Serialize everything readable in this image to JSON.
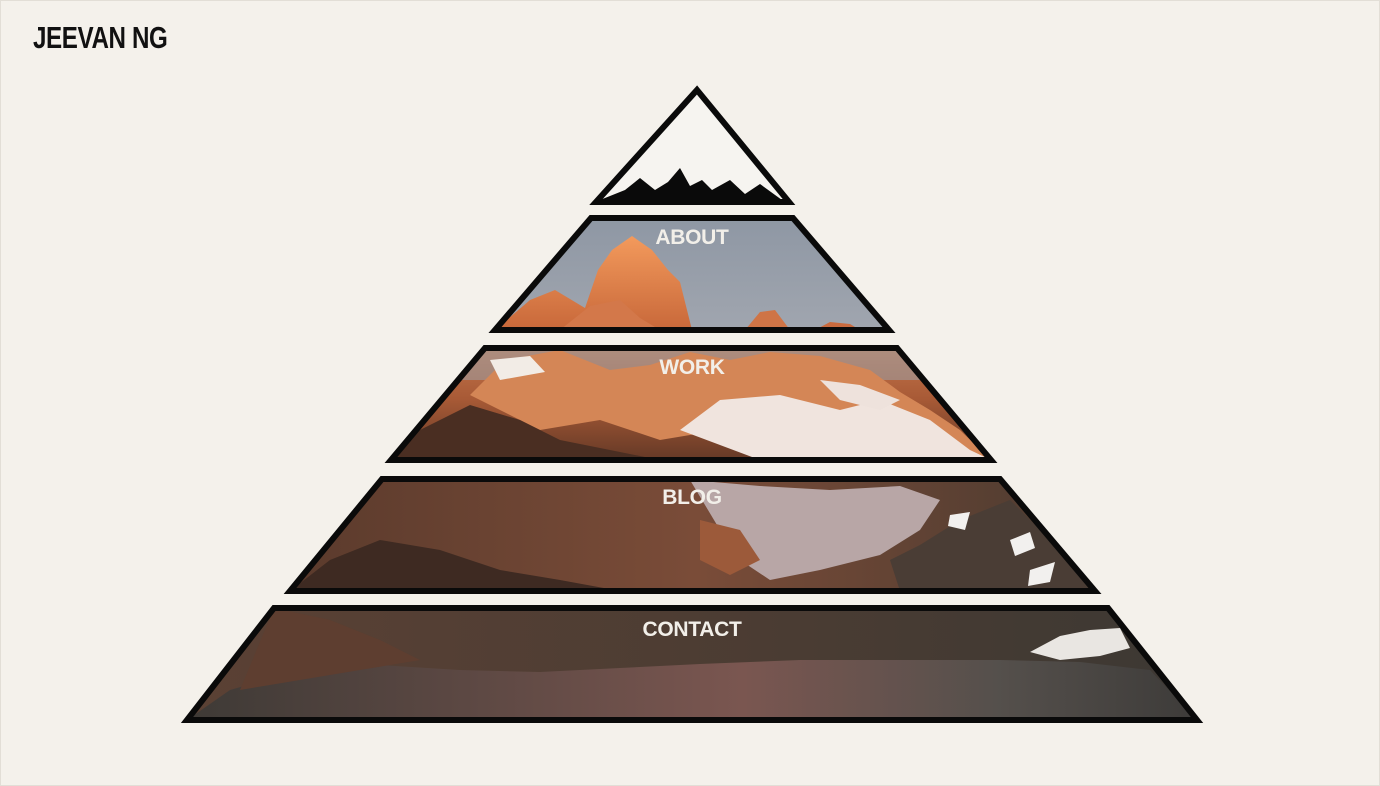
{
  "header": {
    "site_title": "JEEVAN NG"
  },
  "nav": [
    {
      "key": "about",
      "label": "ABOUT"
    },
    {
      "key": "work",
      "label": "WORK"
    },
    {
      "key": "blog",
      "label": "BLOG"
    },
    {
      "key": "contact",
      "label": "CONTACT"
    }
  ],
  "colors": {
    "background": "#f4f1eb",
    "outline": "#0a0a0a",
    "label": "#f2efe9"
  },
  "icons": {
    "summit": "mountain-peak-icon"
  }
}
